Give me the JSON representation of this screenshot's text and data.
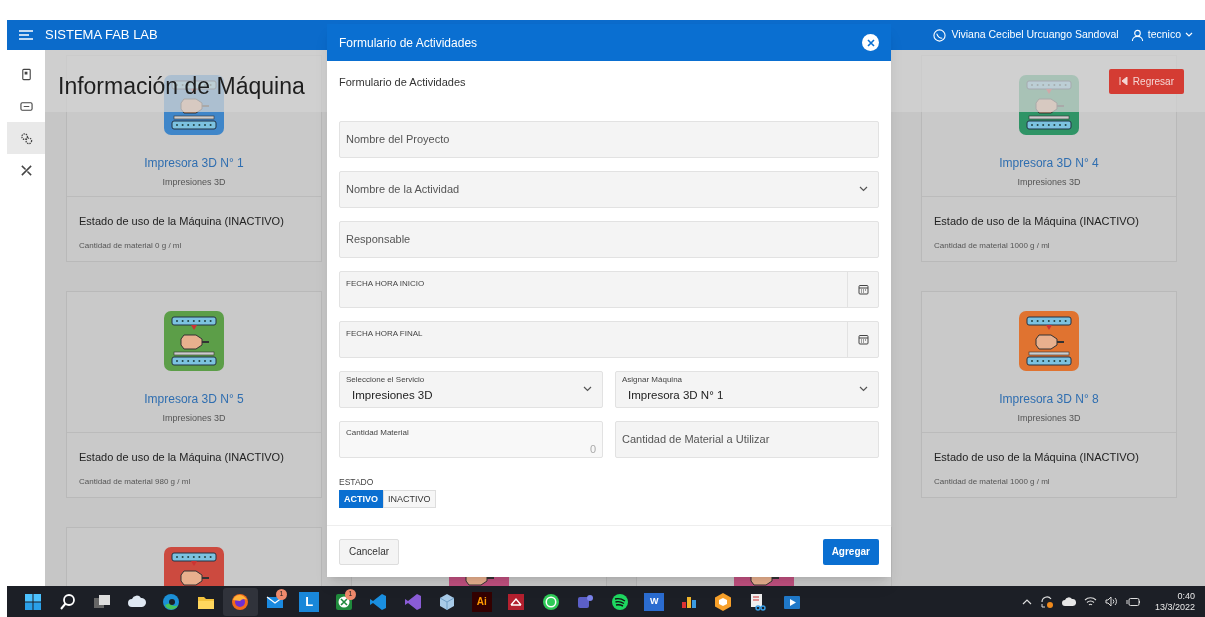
{
  "header": {
    "title": "SISTEMA FAB LAB",
    "user_name": "Viviana Cecibel Urcuango Sandoval",
    "role": "tecnico"
  },
  "sidebar": {
    "items": [
      {
        "selected": false
      },
      {
        "selected": false
      },
      {
        "selected": true
      },
      {
        "selected": false
      }
    ]
  },
  "page": {
    "title": "Información de Máquina",
    "back_button": "Regresar"
  },
  "left_column": [
    {
      "kind": "full",
      "color": "#3f86c9",
      "name": "Impresora 3D N° 1",
      "service": "Impresiones 3D",
      "status": "Estado de uso de la Máquina (INACTIVO)",
      "material": "Cantidad de material 0 g / ml"
    },
    {
      "kind": "full",
      "color": "#5c9e48",
      "name": "Impresora 3D N° 5",
      "service": "Impresiones 3D",
      "status": "Estado de uso de la Máquina (INACTIVO)",
      "material": "Cantidad de material 980 g / ml"
    },
    {
      "kind": "partial",
      "color": "#cc4a3f"
    }
  ],
  "right_column": [
    {
      "kind": "full",
      "color": "#2f9466",
      "name": "Impresora 3D N° 4",
      "service": "Impresiones 3D",
      "status": "Estado de uso de la Máquina (INACTIVO)",
      "material": "Cantidad de material 1000 g / ml"
    },
    {
      "kind": "full",
      "color": "#e07330",
      "name": "Impresora 3D N° 8",
      "service": "Impresiones 3D",
      "status": "Estado de uso de la Máquina (INACTIVO)",
      "material": "Cantidad de material 1000 g / ml"
    }
  ],
  "cards_below_dialog": [
    {
      "color": "#c0507f"
    },
    {
      "color": "#c0507f"
    }
  ],
  "dialog": {
    "title": "Formulario de Actividades",
    "subtitle": "Formulario de Actividades",
    "rows": [
      [
        {
          "kind": "text",
          "placeholder": "Nombre del Proyecto"
        }
      ],
      [
        {
          "kind": "select",
          "placeholder": "Nombre de la Actividad"
        }
      ],
      [
        {
          "kind": "text",
          "placeholder": "Responsable"
        }
      ],
      [
        {
          "kind": "date",
          "label": "FECHA HORA INICIO"
        }
      ],
      [
        {
          "kind": "date",
          "label": "FECHA HORA FINAL"
        }
      ],
      [
        {
          "kind": "select",
          "label": "Seleccione el Servicio",
          "value": "Impresiones 3D"
        },
        {
          "kind": "select",
          "label": "Asignar Máquina",
          "value": "Impresora 3D N° 1"
        }
      ],
      [
        {
          "kind": "number",
          "label": "Cantidad Material",
          "value": "0",
          "disabled": true
        },
        {
          "kind": "text",
          "placeholder": "Cantidad de Material a Utilizar"
        }
      ]
    ],
    "status": {
      "label": "ESTADO",
      "options": [
        {
          "label": "ACTIVO",
          "selected": true
        },
        {
          "label": "INACTIVO",
          "selected": false
        }
      ]
    },
    "buttons": [
      {
        "kind": "secondary",
        "label": "Cancelar"
      },
      {
        "kind": "primary",
        "label": "Agregar"
      }
    ]
  },
  "taskbar": {
    "apps": [
      {
        "active": false
      },
      {
        "active": false
      },
      {
        "active": false
      },
      {
        "active": false
      },
      {
        "active": false
      },
      {
        "active": false
      },
      {
        "active": true
      },
      {
        "active": false,
        "badge": "1"
      },
      {
        "active": false,
        "label": "L"
      },
      {
        "active": false,
        "badge": "1"
      },
      {
        "active": false
      },
      {
        "active": false
      },
      {
        "active": false
      },
      {
        "active": false,
        "label": "Ai"
      },
      {
        "active": false
      },
      {
        "active": false
      },
      {
        "active": false
      },
      {
        "active": false
      },
      {
        "active": false,
        "label": "W"
      },
      {
        "active": false
      },
      {
        "active": false
      },
      {
        "active": false
      },
      {
        "active": false
      }
    ],
    "time": "0:40",
    "date": "13/3/2022"
  }
}
